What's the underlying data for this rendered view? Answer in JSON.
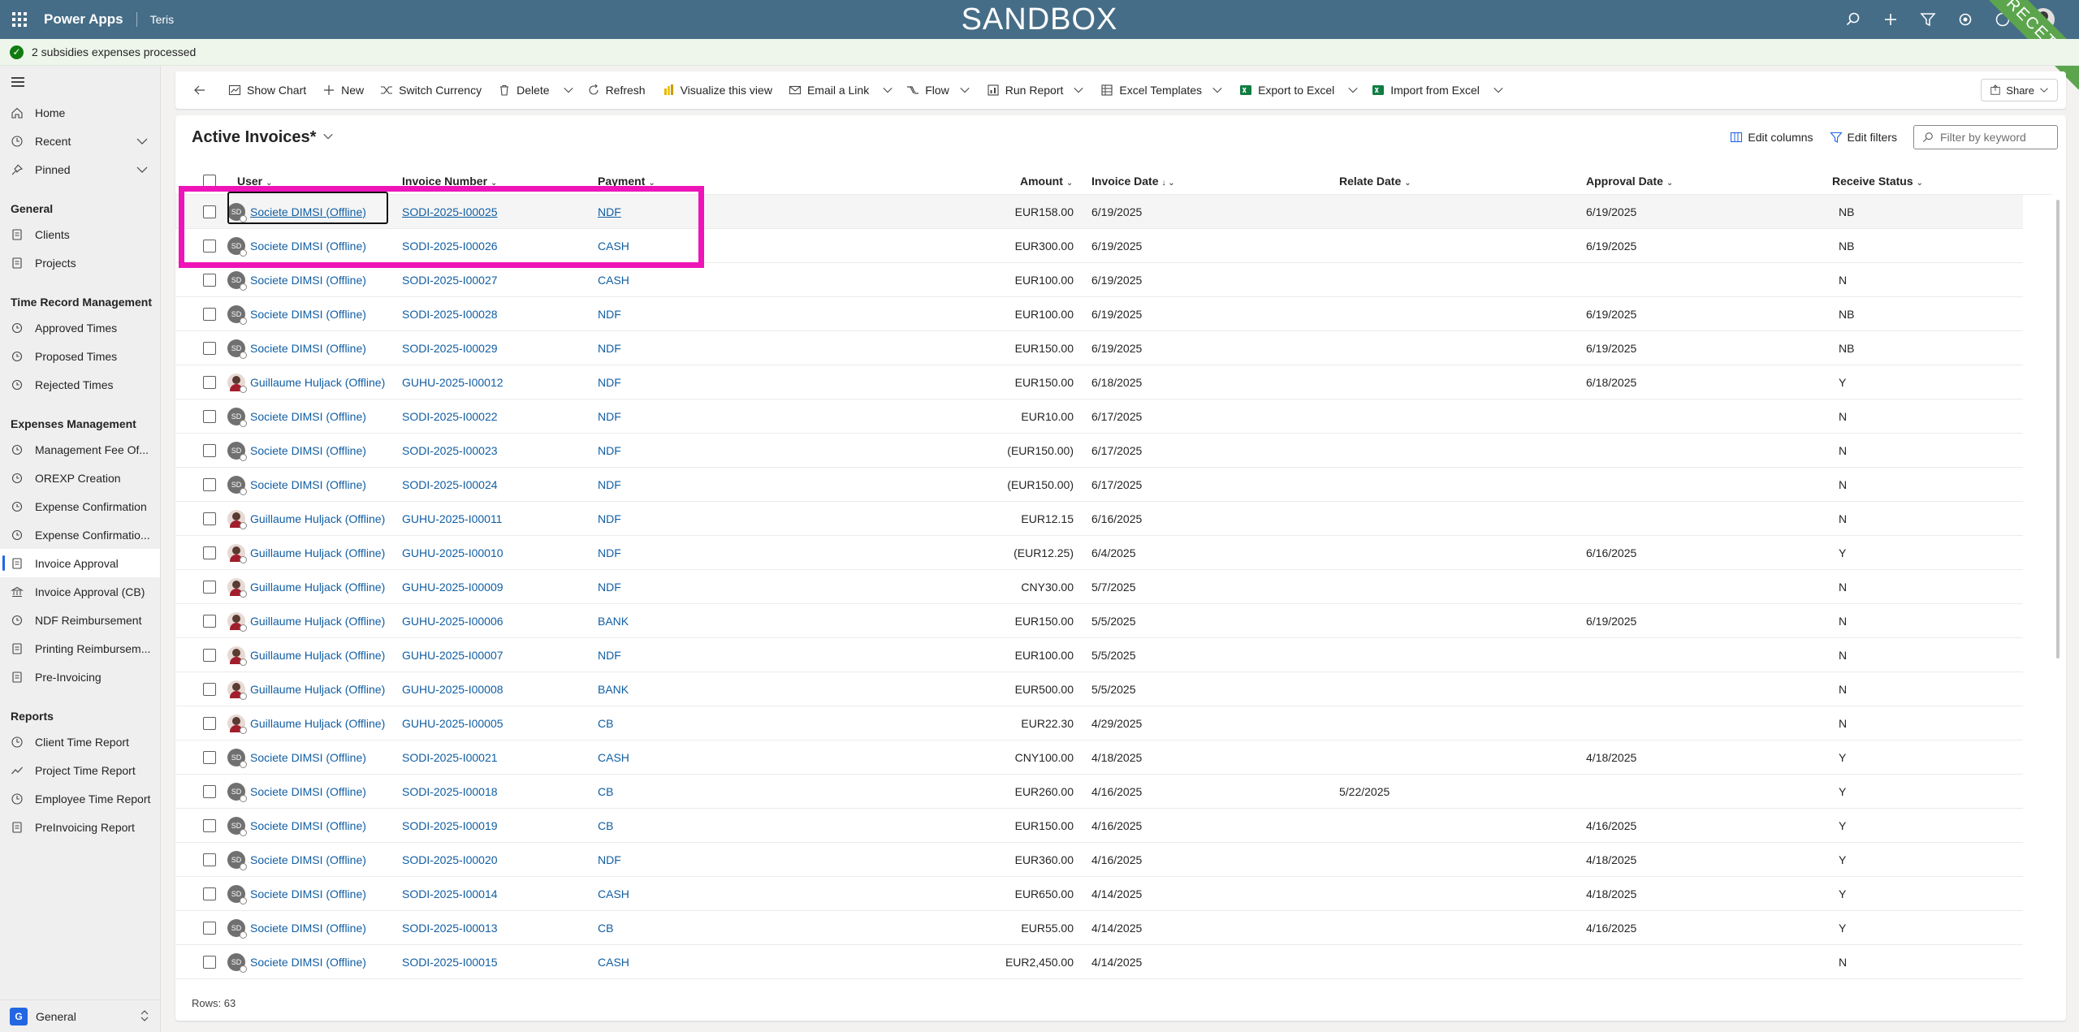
{
  "topbar": {
    "app_name": "Power Apps",
    "environment": "Teris",
    "banner": "SANDBOX",
    "ribbon": "RECETTE"
  },
  "notification": {
    "text": "2 subsidies expenses processed"
  },
  "sidebar": {
    "top": [
      {
        "label": "Home",
        "icon": "home-icon"
      },
      {
        "label": "Recent",
        "icon": "clock-icon"
      },
      {
        "label": "Pinned",
        "icon": "pin-icon"
      }
    ],
    "groups": [
      {
        "title": "General",
        "items": [
          "Clients",
          "Projects"
        ]
      },
      {
        "title": "Time Record Management",
        "items": [
          "Approved Times",
          "Proposed Times",
          "Rejected Times"
        ]
      },
      {
        "title": "Expenses Management",
        "items": [
          "Management Fee Of...",
          "OREXP Creation",
          "Expense Confirmation",
          "Expense Confirmatio...",
          "Invoice Approval",
          "Invoice Approval (CB)",
          "NDF Reimbursement",
          "Printing Reimbursem...",
          "Pre-Invoicing"
        ]
      },
      {
        "title": "Reports",
        "items": [
          "Client Time Report",
          "Project Time Report",
          "Employee Time Report",
          "PreInvoicing Report"
        ]
      }
    ],
    "active": "Invoice Approval",
    "area": {
      "badge": "G",
      "label": "General"
    }
  },
  "commandbar": {
    "show_chart": "Show Chart",
    "new": "New",
    "switch_currency": "Switch Currency",
    "delete": "Delete",
    "refresh": "Refresh",
    "visualize": "Visualize this view",
    "email_link": "Email a Link",
    "flow": "Flow",
    "run_report": "Run Report",
    "excel_templates": "Excel Templates",
    "export_excel": "Export to Excel",
    "import_excel": "Import from Excel",
    "share": "Share"
  },
  "view": {
    "title": "Active Invoices*",
    "edit_columns": "Edit columns",
    "edit_filters": "Edit filters",
    "filter_placeholder": "Filter by keyword",
    "rows_count": "Rows: 63"
  },
  "columns": {
    "user": "User",
    "invoice_number": "Invoice Number",
    "payment": "Payment",
    "amount": "Amount",
    "invoice_date": "Invoice Date",
    "relate_date": "Relate Date",
    "approval_date": "Approval Date",
    "receive_status": "Receive Status"
  },
  "rows": [
    {
      "user": "Societe DIMSI (Offline)",
      "av": "sd",
      "inv": "SODI-2025-I00025",
      "pay": "NDF",
      "amt": "EUR158.00",
      "date": "6/19/2025",
      "rel": "",
      "appr": "6/19/2025",
      "rec": "NB"
    },
    {
      "user": "Societe DIMSI (Offline)",
      "av": "sd",
      "inv": "SODI-2025-I00026",
      "pay": "CASH",
      "amt": "EUR300.00",
      "date": "6/19/2025",
      "rel": "",
      "appr": "6/19/2025",
      "rec": "NB"
    },
    {
      "user": "Societe DIMSI (Offline)",
      "av": "sd",
      "inv": "SODI-2025-I00027",
      "pay": "CASH",
      "amt": "EUR100.00",
      "date": "6/19/2025",
      "rel": "",
      "appr": "",
      "rec": "N"
    },
    {
      "user": "Societe DIMSI (Offline)",
      "av": "sd",
      "inv": "SODI-2025-I00028",
      "pay": "NDF",
      "amt": "EUR100.00",
      "date": "6/19/2025",
      "rel": "",
      "appr": "6/19/2025",
      "rec": "NB"
    },
    {
      "user": "Societe DIMSI (Offline)",
      "av": "sd",
      "inv": "SODI-2025-I00029",
      "pay": "NDF",
      "amt": "EUR150.00",
      "date": "6/19/2025",
      "rel": "",
      "appr": "6/19/2025",
      "rec": "NB"
    },
    {
      "user": "Guillaume Huljack (Offline)",
      "av": "gh",
      "inv": "GUHU-2025-I00012",
      "pay": "NDF",
      "amt": "EUR150.00",
      "date": "6/18/2025",
      "rel": "",
      "appr": "6/18/2025",
      "rec": "Y"
    },
    {
      "user": "Societe DIMSI (Offline)",
      "av": "sd",
      "inv": "SODI-2025-I00022",
      "pay": "NDF",
      "amt": "EUR10.00",
      "date": "6/17/2025",
      "rel": "",
      "appr": "",
      "rec": "N"
    },
    {
      "user": "Societe DIMSI (Offline)",
      "av": "sd",
      "inv": "SODI-2025-I00023",
      "pay": "NDF",
      "amt": "(EUR150.00)",
      "date": "6/17/2025",
      "rel": "",
      "appr": "",
      "rec": "N"
    },
    {
      "user": "Societe DIMSI (Offline)",
      "av": "sd",
      "inv": "SODI-2025-I00024",
      "pay": "NDF",
      "amt": "(EUR150.00)",
      "date": "6/17/2025",
      "rel": "",
      "appr": "",
      "rec": "N"
    },
    {
      "user": "Guillaume Huljack (Offline)",
      "av": "gh",
      "inv": "GUHU-2025-I00011",
      "pay": "NDF",
      "amt": "EUR12.15",
      "date": "6/16/2025",
      "rel": "",
      "appr": "",
      "rec": "N"
    },
    {
      "user": "Guillaume Huljack (Offline)",
      "av": "gh",
      "inv": "GUHU-2025-I00010",
      "pay": "NDF",
      "amt": "(EUR12.25)",
      "date": "6/4/2025",
      "rel": "",
      "appr": "6/16/2025",
      "rec": "Y"
    },
    {
      "user": "Guillaume Huljack (Offline)",
      "av": "gh",
      "inv": "GUHU-2025-I00009",
      "pay": "NDF",
      "amt": "CNY30.00",
      "date": "5/7/2025",
      "rel": "",
      "appr": "",
      "rec": "N"
    },
    {
      "user": "Guillaume Huljack (Offline)",
      "av": "gh",
      "inv": "GUHU-2025-I00006",
      "pay": "BANK",
      "amt": "EUR150.00",
      "date": "5/5/2025",
      "rel": "",
      "appr": "6/19/2025",
      "rec": "N"
    },
    {
      "user": "Guillaume Huljack (Offline)",
      "av": "gh",
      "inv": "GUHU-2025-I00007",
      "pay": "NDF",
      "amt": "EUR100.00",
      "date": "5/5/2025",
      "rel": "",
      "appr": "",
      "rec": "N"
    },
    {
      "user": "Guillaume Huljack (Offline)",
      "av": "gh",
      "inv": "GUHU-2025-I00008",
      "pay": "BANK",
      "amt": "EUR500.00",
      "date": "5/5/2025",
      "rel": "",
      "appr": "",
      "rec": "N"
    },
    {
      "user": "Guillaume Huljack (Offline)",
      "av": "gh",
      "inv": "GUHU-2025-I00005",
      "pay": "CB",
      "amt": "EUR22.30",
      "date": "4/29/2025",
      "rel": "",
      "appr": "",
      "rec": "N"
    },
    {
      "user": "Societe DIMSI (Offline)",
      "av": "sd",
      "inv": "SODI-2025-I00021",
      "pay": "CASH",
      "amt": "CNY100.00",
      "date": "4/18/2025",
      "rel": "",
      "appr": "4/18/2025",
      "rec": "Y"
    },
    {
      "user": "Societe DIMSI (Offline)",
      "av": "sd",
      "inv": "SODI-2025-I00018",
      "pay": "CB",
      "amt": "EUR260.00",
      "date": "4/16/2025",
      "rel": "5/22/2025",
      "appr": "",
      "rec": "Y"
    },
    {
      "user": "Societe DIMSI (Offline)",
      "av": "sd",
      "inv": "SODI-2025-I00019",
      "pay": "CB",
      "amt": "EUR150.00",
      "date": "4/16/2025",
      "rel": "",
      "appr": "4/16/2025",
      "rec": "Y"
    },
    {
      "user": "Societe DIMSI (Offline)",
      "av": "sd",
      "inv": "SODI-2025-I00020",
      "pay": "NDF",
      "amt": "EUR360.00",
      "date": "4/16/2025",
      "rel": "",
      "appr": "4/18/2025",
      "rec": "Y"
    },
    {
      "user": "Societe DIMSI (Offline)",
      "av": "sd",
      "inv": "SODI-2025-I00014",
      "pay": "CASH",
      "amt": "EUR650.00",
      "date": "4/14/2025",
      "rel": "",
      "appr": "4/18/2025",
      "rec": "Y"
    },
    {
      "user": "Societe DIMSI (Offline)",
      "av": "sd",
      "inv": "SODI-2025-I00013",
      "pay": "CB",
      "amt": "EUR55.00",
      "date": "4/14/2025",
      "rel": "",
      "appr": "4/16/2025",
      "rec": "Y"
    },
    {
      "user": "Societe DIMSI (Offline)",
      "av": "sd",
      "inv": "SODI-2025-I00015",
      "pay": "CASH",
      "amt": "EUR2,450.00",
      "date": "4/14/2025",
      "rel": "",
      "appr": "",
      "rec": "N"
    }
  ]
}
